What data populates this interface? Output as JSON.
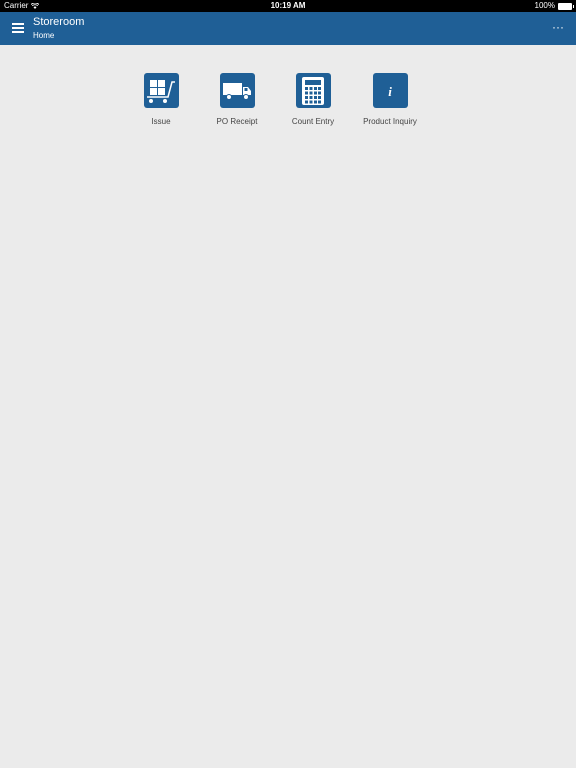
{
  "status_bar": {
    "carrier": "Carrier",
    "time": "10:19 AM",
    "battery": "100%"
  },
  "header": {
    "title": "Storeroom",
    "subtitle": "Home",
    "more_label": "···"
  },
  "tiles": [
    {
      "label": "Issue",
      "icon": "cart-icon"
    },
    {
      "label": "PO Receipt",
      "icon": "truck-icon"
    },
    {
      "label": "Count Entry",
      "icon": "calculator-icon"
    },
    {
      "label": "Product Inquiry",
      "icon": "info-icon"
    }
  ],
  "colors": {
    "header_bg": "#1f5f96",
    "page_bg": "#ebebeb",
    "tile_bg": "#1f5f96"
  }
}
